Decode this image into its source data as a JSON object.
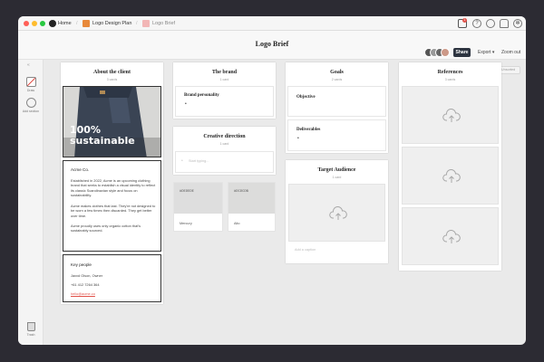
{
  "titlebar": {
    "home_label": "Home",
    "tab1_label": "Logo Design Plan",
    "tab2_label": "Logo Brief",
    "notif_count": "1"
  },
  "header": {
    "board_title": "Logo Brief",
    "share_label": "Share",
    "export_label": "Export ▾",
    "zoom_label": "Zoom out",
    "unsorted_label": "0 Unsorted"
  },
  "sidebar": {
    "tool1_label": "Draw",
    "tool2_label": "Add section",
    "trash_label": "Trash"
  },
  "col_client": {
    "title": "About the client",
    "sub": "3 cards",
    "image_text_line1": "100%",
    "image_text_line2": "sustainable",
    "acme_heading": "Acme Co.",
    "acme_p1": "Established in 2022, Acme is an upcoming clothing brand that seeks to establish a visual identity to reflect its classic Scandinavian style and focus on sustainability.",
    "acme_p2": "Acme makes clothes that last. They're not designed to be worn a few times then discarded. They get better over time.",
    "acme_p3": "Acme proudly uses only organic cotton that's sustainably sourced.",
    "key_heading": "Key people",
    "key_name": "Jaxxd Olson, Owner",
    "key_phone": "+61 412 7264 364",
    "key_email": "hello@acme.co"
  },
  "col_brand": {
    "title": "The brand",
    "sub": "1 card",
    "personality_heading": "Brand personality",
    "creative_title": "Creative direction",
    "creative_sub": "1 card",
    "creative_placeholder": "Start typing...",
    "swatch1_hex": "#DEDEDE",
    "swatch1_name": "Mercury",
    "swatch2_hex": "#DCDCDB",
    "swatch2_name": "Alto"
  },
  "col_goals": {
    "title": "Goals",
    "sub": "2 cards",
    "objective_heading": "Objective",
    "deliverables_heading": "Deliverables",
    "target_title": "Target Audience",
    "target_sub": "1 card",
    "caption_placeholder": "Add a caption"
  },
  "col_refs": {
    "title": "References",
    "sub": "3 cards"
  },
  "colors": {
    "share_bg": "#2d3440",
    "link_red": "#e2524a",
    "swatch1": "#dedede",
    "swatch2": "#dcdcdb"
  }
}
